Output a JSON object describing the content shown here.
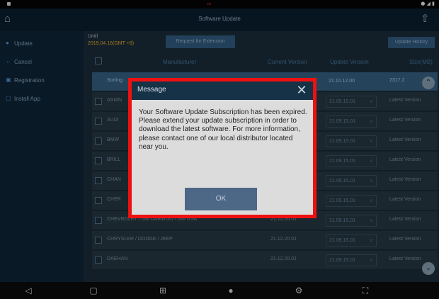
{
  "app": {
    "title": "Software Update"
  },
  "sidebar": {
    "items": [
      {
        "label": "Update",
        "icon": "update-icon"
      },
      {
        "label": "Cancel",
        "icon": "back-arrow-icon"
      },
      {
        "label": "Registration",
        "icon": "registration-icon"
      },
      {
        "label": "Install App",
        "icon": "install-icon"
      }
    ]
  },
  "header": {
    "unit_label": "Until",
    "unit_date": "2019.04.16(GMT +8)",
    "request_extension_label": "Request for Extension",
    "update_history_label": "Update History"
  },
  "table": {
    "columns": [
      "Manufacturer",
      "Current Version",
      "Update Version",
      "Size(MB)"
    ],
    "rows": [
      {
        "manufacturer": "Sorting",
        "current": "",
        "update": "21.10.12.00",
        "size": "2317.2",
        "highlight": true
      },
      {
        "manufacturer": "ASIAN",
        "current": "",
        "update": "21.09.15.01",
        "size": "Latest Version",
        "highlight": false
      },
      {
        "manufacturer": "AUDI",
        "current": "",
        "update": "21.09.15.01",
        "size": "Latest Version",
        "highlight": false
      },
      {
        "manufacturer": "BMW",
        "current": "",
        "update": "21.09.15.01",
        "size": "Latest Version",
        "highlight": false
      },
      {
        "manufacturer": "BRILL",
        "current": "",
        "update": "21.09.15.01",
        "size": "Latest Version",
        "highlight": false
      },
      {
        "manufacturer": "CHAN",
        "current": "",
        "update": "21.09.15.01",
        "size": "Latest Version",
        "highlight": false
      },
      {
        "manufacturer": "CHER",
        "current": "",
        "update": "21.09.15.01",
        "size": "Latest Version",
        "highlight": false
      },
      {
        "manufacturer": "CHEVROLET / GM DAEWOO / GM USA",
        "current": "21.12.20.01",
        "update": "21.09.15.01",
        "size": "Latest Version",
        "highlight": false
      },
      {
        "manufacturer": "CHRYSLER / DODGE / JEEP",
        "current": "21.12.20.01",
        "update": "21.09.15.01",
        "size": "Latest Version",
        "highlight": false
      },
      {
        "manufacturer": "DAEHAN",
        "current": "21.12.20.01",
        "update": "21.09.15.01",
        "size": "Latest Version",
        "highlight": false
      }
    ]
  },
  "dialog": {
    "title": "Message",
    "body": "Your Software Update Subscription has been expired. Please extend your update subscription in order to download the latest software. For more information, please contact one of our local distributor located near you.",
    "ok_label": "OK"
  },
  "colors": {
    "dialog_border": "#ee1111",
    "dialog_header": "#163247",
    "ok_button": "#4d6786",
    "date_accent": "#d9a12a"
  }
}
